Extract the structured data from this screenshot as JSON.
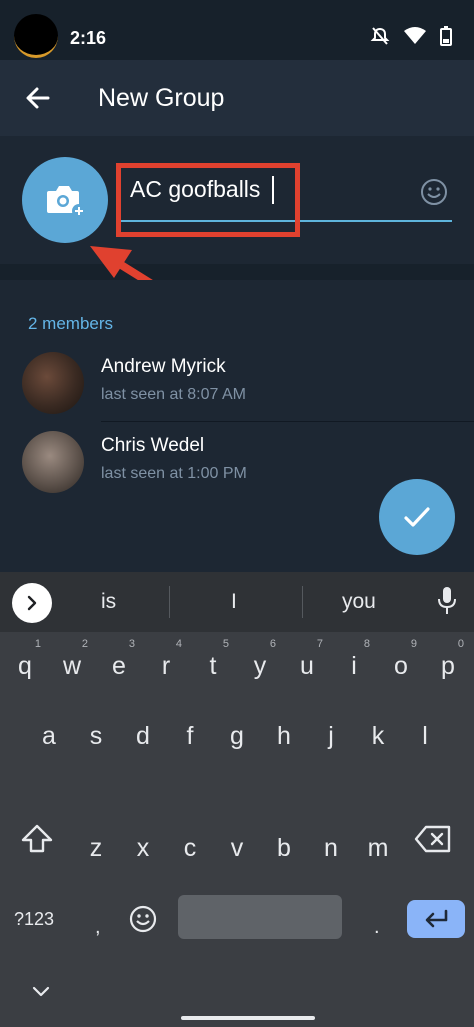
{
  "status_bar": {
    "time": "2:16"
  },
  "app_bar": {
    "title": "New Group"
  },
  "group_form": {
    "name_value": "AC goofballs"
  },
  "members": {
    "count_label": "2 members",
    "list": [
      {
        "name": "Andrew Myrick",
        "last_seen": "last seen at 8:07 AM"
      },
      {
        "name": "Chris Wedel",
        "last_seen": "last seen at 1:00 PM"
      }
    ]
  },
  "keyboard": {
    "suggestions": [
      "is",
      "I",
      "you"
    ],
    "row1": [
      {
        "ch": "q",
        "num": "1"
      },
      {
        "ch": "w",
        "num": "2"
      },
      {
        "ch": "e",
        "num": "3"
      },
      {
        "ch": "r",
        "num": "4"
      },
      {
        "ch": "t",
        "num": "5"
      },
      {
        "ch": "y",
        "num": "6"
      },
      {
        "ch": "u",
        "num": "7"
      },
      {
        "ch": "i",
        "num": "8"
      },
      {
        "ch": "o",
        "num": "9"
      },
      {
        "ch": "p",
        "num": "0"
      }
    ],
    "row2": [
      "a",
      "s",
      "d",
      "f",
      "g",
      "h",
      "j",
      "k",
      "l"
    ],
    "row3": [
      "z",
      "x",
      "c",
      "v",
      "b",
      "n",
      "m"
    ],
    "symbols_label": "?123",
    "comma_label": ",",
    "period_label": "."
  },
  "colors": {
    "accent": "#5ba7d6",
    "highlight_box": "#e0412f",
    "members_label": "#64b5e7"
  }
}
